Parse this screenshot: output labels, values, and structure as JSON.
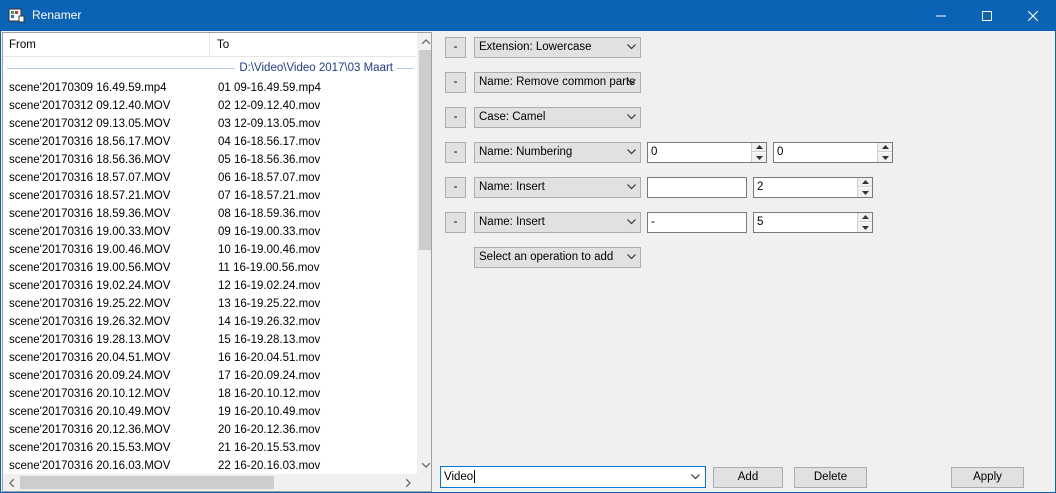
{
  "window": {
    "title": "Renamer"
  },
  "list": {
    "columns": {
      "from": "From",
      "to": "To"
    },
    "group_label": "D:\\Video\\Video 2017\\03 Maart",
    "rows": [
      {
        "from": "scene'20170309 16.49.59.mp4",
        "to": "01 09-16.49.59.mp4"
      },
      {
        "from": "scene'20170312 09.12.40.MOV",
        "to": "02 12-09.12.40.mov"
      },
      {
        "from": "scene'20170312 09.13.05.MOV",
        "to": "03 12-09.13.05.mov"
      },
      {
        "from": "scene'20170316 18.56.17.MOV",
        "to": "04 16-18.56.17.mov"
      },
      {
        "from": "scene'20170316 18.56.36.MOV",
        "to": "05 16-18.56.36.mov"
      },
      {
        "from": "scene'20170316 18.57.07.MOV",
        "to": "06 16-18.57.07.mov"
      },
      {
        "from": "scene'20170316 18.57.21.MOV",
        "to": "07 16-18.57.21.mov"
      },
      {
        "from": "scene'20170316 18.59.36.MOV",
        "to": "08 16-18.59.36.mov"
      },
      {
        "from": "scene'20170316 19.00.33.MOV",
        "to": "09 16-19.00.33.mov"
      },
      {
        "from": "scene'20170316 19.00.46.MOV",
        "to": "10 16-19.00.46.mov"
      },
      {
        "from": "scene'20170316 19.00.56.MOV",
        "to": "11 16-19.00.56.mov"
      },
      {
        "from": "scene'20170316 19.02.24.MOV",
        "to": "12 16-19.02.24.mov"
      },
      {
        "from": "scene'20170316 19.25.22.MOV",
        "to": "13 16-19.25.22.mov"
      },
      {
        "from": "scene'20170316 19.26.32.MOV",
        "to": "14 16-19.26.32.mov"
      },
      {
        "from": "scene'20170316 19.28.13.MOV",
        "to": "15 16-19.28.13.mov"
      },
      {
        "from": "scene'20170316 20.04.51.MOV",
        "to": "16 16-20.04.51.mov"
      },
      {
        "from": "scene'20170316 20.09.24.MOV",
        "to": "17 16-20.09.24.mov"
      },
      {
        "from": "scene'20170316 20.10.12.MOV",
        "to": "18 16-20.10.12.mov"
      },
      {
        "from": "scene'20170316 20.10.49.MOV",
        "to": "19 16-20.10.49.mov"
      },
      {
        "from": "scene'20170316 20.12.36.MOV",
        "to": "20 16-20.12.36.mov"
      },
      {
        "from": "scene'20170316 20.15.53.MOV",
        "to": "21 16-20.15.53.mov"
      },
      {
        "from": "scene'20170316 20.16.03.MOV",
        "to": "22 16-20.16.03.mov"
      }
    ]
  },
  "operations": {
    "remove_label": "-",
    "items": [
      {
        "operation": "Extension: Lowercase"
      },
      {
        "operation": "Name: Remove common parts"
      },
      {
        "operation": "Case: Camel"
      },
      {
        "operation": "Name: Numbering",
        "value1": "0",
        "value2": "0"
      },
      {
        "operation": "Name: Insert",
        "text": "",
        "value": "2"
      },
      {
        "operation": "Name: Insert",
        "text": "-",
        "value": "5"
      }
    ],
    "add_placeholder": "Select an operation to add"
  },
  "bottom": {
    "preset_value": "Video",
    "add_label": "Add",
    "delete_label": "Delete",
    "apply_label": "Apply"
  },
  "colors": {
    "titlebar": "#0b63b6",
    "group_text": "#1e3c8c"
  }
}
